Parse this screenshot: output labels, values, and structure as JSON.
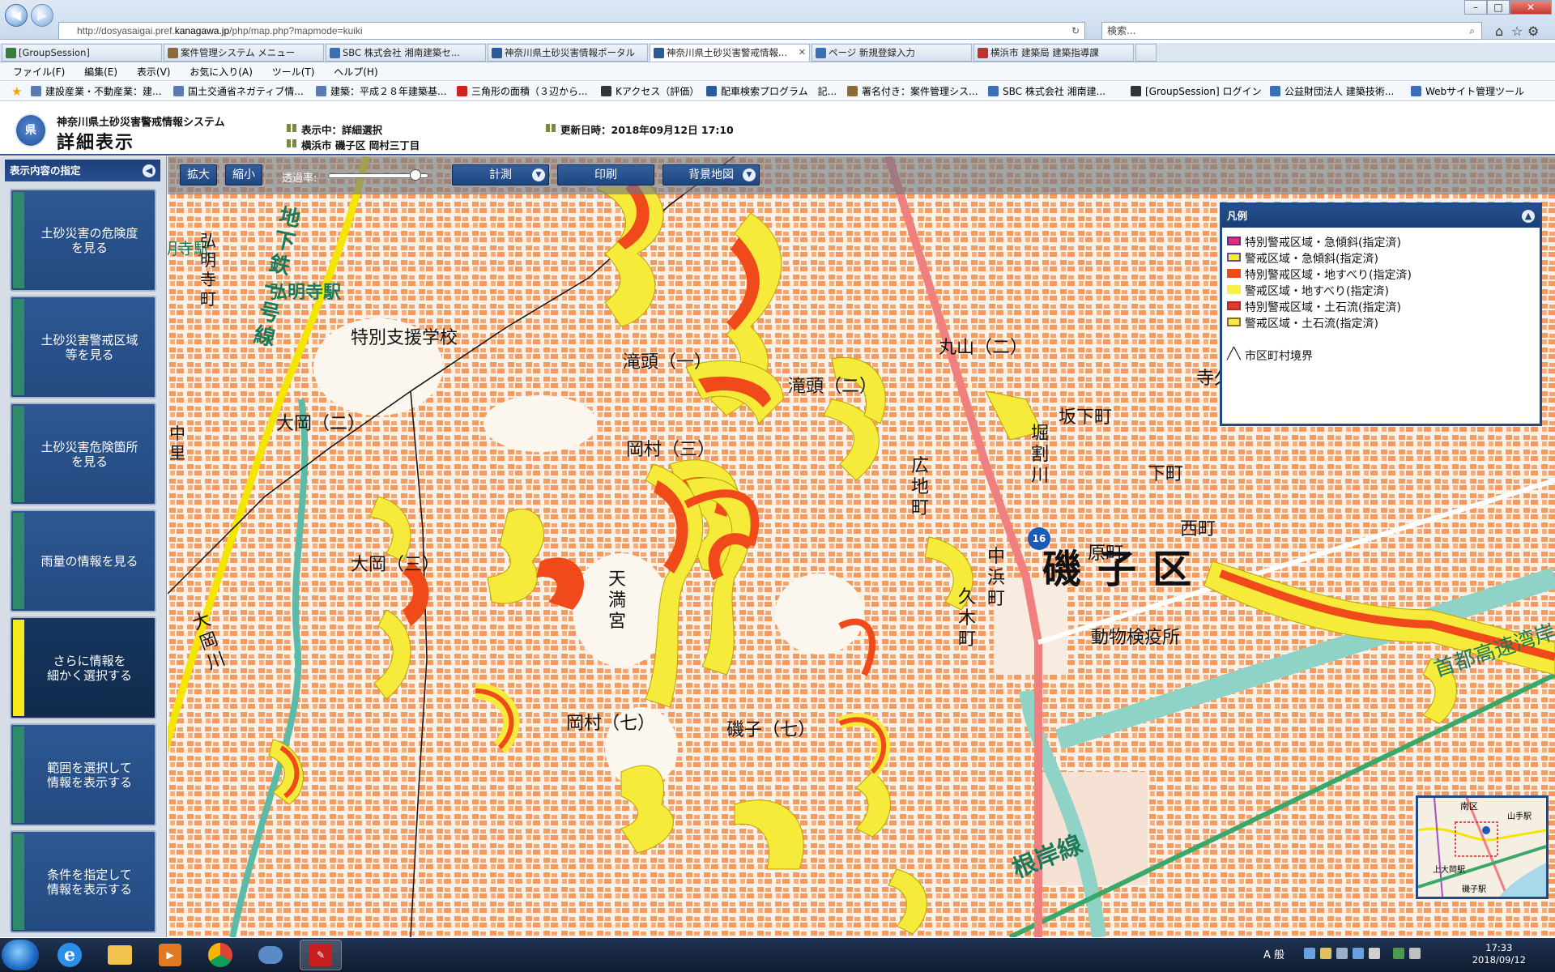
{
  "browser": {
    "url_prefix": "http://dosyasaigai.pref.",
    "url_domain": "kanagawa.jp",
    "url_suffix": "/php/map.php?mapmode=kuiki",
    "search_placeholder": "検索...",
    "tabs": [
      {
        "label": "[GroupSession]",
        "color": "#3a7a3a"
      },
      {
        "label": "案件管理システム メニュー",
        "color": "#8b6b3a"
      },
      {
        "label": "SBC 株式会社 湘南建築セ...",
        "color": "#3a6fb8"
      },
      {
        "label": "神奈川県土砂災害情報ポータル",
        "color": "#2a5a9a"
      },
      {
        "label": "神奈川県土砂災害警戒情報...",
        "color": "#2a5a9a"
      },
      {
        "label": "ページ 新規登録入力",
        "color": "#3a6fb8"
      },
      {
        "label": "横浜市 建築局 建築指導課",
        "color": "#c03030"
      }
    ],
    "menu": [
      "ファイル(F)",
      "編集(E)",
      "表示(V)",
      "お気に入り(A)",
      "ツール(T)",
      "ヘルプ(H)"
    ],
    "favorites": [
      {
        "label": "建設産業・不動産業：建...",
        "color": "#5a7ab0"
      },
      {
        "label": "国土交通省ネガティブ情...",
        "color": "#5a7ab0"
      },
      {
        "label": "建築：平成２８年建築基...",
        "color": "#5a7ab0"
      },
      {
        "label": "三角形の面積（３辺から...",
        "color": "#d02020"
      },
      {
        "label": "Kアクセス（評価）",
        "color": "#333"
      },
      {
        "label": "配車検索プログラム　記...",
        "color": "#2a5a9a"
      },
      {
        "label": "署名付き：案件管理シス...",
        "color": "#8b6b3a"
      },
      {
        "label": "SBC 株式会社 湘南建...",
        "color": "#3a6fb8"
      },
      {
        "label": "[GroupSession] ログイン",
        "color": "#333"
      },
      {
        "label": "公益財団法人 建築技術...",
        "color": "#3a6fb8"
      },
      {
        "label": "Webサイト管理ツール",
        "color": "#3a6fb8"
      }
    ]
  },
  "header": {
    "logo_text": "県",
    "system_name": "神奈川県土砂災害警戒情報システム",
    "page_title": "詳細表示",
    "display_mode": "表示中：詳細選択",
    "location": "横浜市 磯子区 岡村三丁目",
    "updated": "更新日時：2018年09月12日 17:10"
  },
  "left_panel": {
    "title": "表示内容の指定",
    "buttons": [
      {
        "label1": "土砂災害の危険度",
        "label2": "を見る",
        "selected": false
      },
      {
        "label1": "土砂災害警戒区域",
        "label2": "等を見る",
        "selected": false
      },
      {
        "label1": "土砂災害危険箇所",
        "label2": "を見る",
        "selected": false
      },
      {
        "label1": "雨量の情報を見る",
        "label2": "",
        "selected": false
      },
      {
        "label1": "さらに情報を",
        "label2": "細かく選択する",
        "selected": true
      },
      {
        "label1": "範囲を選択して",
        "label2": "情報を表示する",
        "selected": false
      },
      {
        "label1": "条件を指定して",
        "label2": "情報を表示する",
        "selected": false
      }
    ]
  },
  "toolbar": {
    "zoom_in": "拡大",
    "zoom_out": "縮小",
    "opacity_label": "透過率:",
    "opacity_value": 0.92,
    "measure": "計測",
    "print": "印刷",
    "background_map": "背景地図"
  },
  "legend": {
    "title": "凡例",
    "items": [
      {
        "label": "特別警戒区域・急傾斜(指定済)",
        "fill": "#e0306a",
        "border": "#6a2a8a"
      },
      {
        "label": "警戒区域・急傾斜(指定済)",
        "fill": "#f6ea3a",
        "border": "#6a4ab0"
      },
      {
        "label": "特別警戒区域・地すべり(指定済)",
        "fill": "#f04a1a",
        "border": "#f04a1a"
      },
      {
        "label": "警戒区域・地すべり(指定済)",
        "fill": "#f8f04a",
        "border": "#f8f04a"
      },
      {
        "label": "特別警戒区域・土石流(指定済)",
        "fill": "#e03a2a",
        "border": "#b02a2a"
      },
      {
        "label": "警戒区域・土石流(指定済)",
        "fill": "#f6ea3a",
        "border": "#8a6a2a"
      }
    ],
    "boundary_label": "市区町村境界"
  },
  "map_labels": {
    "ward": "磯子区",
    "route_number": "16",
    "subway": "地下鉄一号線",
    "subway_station": "弘明寺駅",
    "negishi_line": "根岸線",
    "expressway": "首都高速湾岸",
    "school": "特別支援学校",
    "quarantine": "動物検疫所",
    "shrine": "天満宮",
    "maruyama": "丸山（二）",
    "takigashira2": "滝頭（二）",
    "takigashira1": "滝頭（一）",
    "okamura3": "岡村（三）",
    "okamura7": "岡村（七）",
    "ooka2": "大岡（二）",
    "ooka3": "大岡（三）",
    "jikyubo": "寺久保",
    "sakashitacho": "坂下町",
    "shimocho": "下町",
    "haracho": "原町",
    "nishimachi": "西町",
    "horiwarigawa": "堀割川",
    "hiroji": "広地町",
    "nakahama": "中浜町",
    "kuki": "久木町",
    "ookagawa": "大岡川",
    "gumyoji_cho": "弘明寺町",
    "gumyoji_eki": "明寺駅",
    "nakazato": "中里",
    "isogo7": "磯子（七）",
    "minimap_label1": "南区",
    "minimap_label2": "山手駅",
    "minimap_label3": "上大岡駅",
    "minimap_label4": "磯子駅"
  },
  "taskbar": {
    "time": "17:33",
    "date": "2018/09/12",
    "ime": "A 般"
  }
}
